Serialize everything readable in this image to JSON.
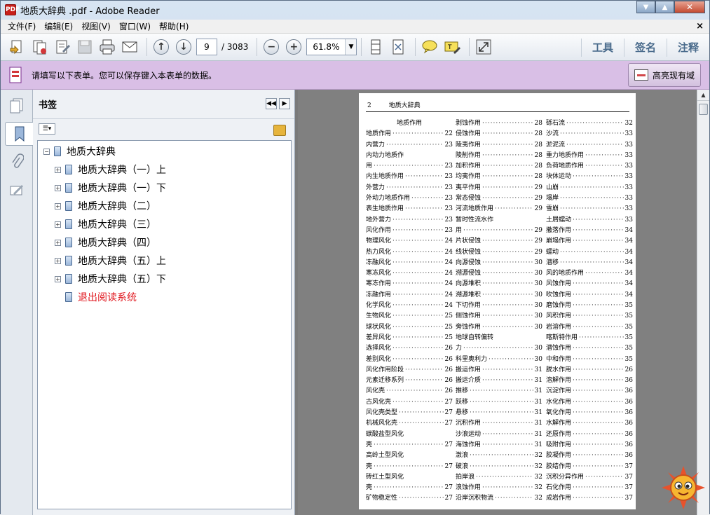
{
  "window": {
    "title": "地质大辞典 .pdf - Adobe Reader",
    "app_icon_label": "PDF"
  },
  "window_buttons": {
    "minimize": "▼",
    "maximize": "▲",
    "close": "✕"
  },
  "menu": {
    "items": [
      "文件(F)",
      "编辑(E)",
      "视图(V)",
      "窗口(W)",
      "帮助(H)"
    ],
    "close": "×"
  },
  "toolbar": {
    "page_current": "9",
    "page_total": "/ 3083",
    "zoom": "61.8%",
    "zoom_out": "−",
    "zoom_in": "+",
    "tools_label": "工具",
    "sign_label": "签名",
    "comment_label": "注释"
  },
  "form_bar": {
    "message": "请填写以下表单。您可以保存键入本表单的数据。",
    "highlight_button": "高亮现有域"
  },
  "bookmarks": {
    "title": "书签",
    "root": "地质大辞典",
    "items": [
      "地质大辞典（一）上",
      "地质大辞典（一）下",
      "地质大辞典（二）",
      "地质大辞典（三）",
      "地质大辞典（四）",
      "地质大辞典（五）上",
      "地质大辞典（五）下"
    ],
    "exit_item": "退出阅读系统"
  },
  "page": {
    "number": "2",
    "running_title": "地质大辞典",
    "columns": [
      [
        {
          "t": "地质作用",
          "h": true
        },
        {
          "t": "地质作用",
          "p": "22"
        },
        {
          "t": "内营力",
          "p": "23"
        },
        {
          "t": "内动力地质作",
          "nop": true
        },
        {
          "t": "用",
          "p": "23"
        },
        {
          "t": "内生地质作用",
          "p": "23"
        },
        {
          "t": "外营力",
          "p": "23"
        },
        {
          "t": "外动力地质作用",
          "p": "23"
        },
        {
          "t": "表生地质作用",
          "p": "23"
        },
        {
          "t": "地外营力",
          "p": "23"
        },
        {
          "t": "风化作用",
          "p": "23"
        },
        {
          "t": "物理风化",
          "p": "24"
        },
        {
          "t": "热力风化",
          "p": "24"
        },
        {
          "t": "冻融风化",
          "p": "24"
        },
        {
          "t": "寒冻风化",
          "p": "24"
        },
        {
          "t": "寒冻作用",
          "p": "24"
        },
        {
          "t": "冻融作用",
          "p": "24"
        },
        {
          "t": "化学风化",
          "p": "24"
        },
        {
          "t": "生物风化",
          "p": "25"
        },
        {
          "t": "球状风化",
          "p": "25"
        },
        {
          "t": "差异风化",
          "p": "25"
        },
        {
          "t": "选择风化",
          "p": "26"
        },
        {
          "t": "差别风化",
          "p": "26"
        },
        {
          "t": "风化作用阶段",
          "p": "26"
        },
        {
          "t": "元素迁移系列",
          "p": "26"
        },
        {
          "t": "风化壳",
          "p": "26"
        },
        {
          "t": "古风化壳",
          "p": "27"
        },
        {
          "t": "风化壳类型",
          "p": "27"
        },
        {
          "t": "机械风化壳",
          "p": "27"
        },
        {
          "t": "碳酸盐型风化",
          "nop": true
        },
        {
          "t": "壳",
          "p": "27"
        },
        {
          "t": "高岭土型风化",
          "nop": true
        },
        {
          "t": "壳",
          "p": "27"
        },
        {
          "t": "砖红土型风化",
          "nop": true
        },
        {
          "t": "壳",
          "p": "27"
        },
        {
          "t": "矿物稳定性",
          "p": "27"
        }
      ],
      [
        {
          "t": "剥蚀作用",
          "p": "28"
        },
        {
          "t": "侵蚀作用",
          "p": "28"
        },
        {
          "t": "陵夷作用",
          "p": "28"
        },
        {
          "t": "陵削作用",
          "p": "28"
        },
        {
          "t": "加积作用",
          "p": "28"
        },
        {
          "t": "均夷作用",
          "p": "28"
        },
        {
          "t": "夷平作用",
          "p": "29"
        },
        {
          "t": "常态侵蚀",
          "p": "29"
        },
        {
          "t": "河流地质作用",
          "p": "29"
        },
        {
          "t": "暂时性流水作",
          "nop": true
        },
        {
          "t": "用",
          "p": "29"
        },
        {
          "t": "片状侵蚀",
          "p": "29"
        },
        {
          "t": "线状侵蚀",
          "p": "29"
        },
        {
          "t": "向源侵蚀",
          "p": "30"
        },
        {
          "t": "溯源侵蚀",
          "p": "30"
        },
        {
          "t": "向源堆积",
          "p": "30"
        },
        {
          "t": "溯源堆积",
          "p": "30"
        },
        {
          "t": "下切作用",
          "p": "30"
        },
        {
          "t": "侧蚀作用",
          "p": "30"
        },
        {
          "t": "旁蚀作用",
          "p": "30"
        },
        {
          "t": "地球自转偏转",
          "nop": true
        },
        {
          "t": "力",
          "p": "30"
        },
        {
          "t": "科里奥利力",
          "p": "30"
        },
        {
          "t": "搬运作用",
          "p": "31"
        },
        {
          "t": "搬运介质",
          "p": "31"
        },
        {
          "t": "推移",
          "p": "31"
        },
        {
          "t": "跃移",
          "p": "31"
        },
        {
          "t": "悬移",
          "p": "31"
        },
        {
          "t": "沉积作用",
          "p": "31"
        },
        {
          "t": "沙浪运动",
          "p": "31"
        },
        {
          "t": "海蚀作用",
          "p": "31"
        },
        {
          "t": "激浪",
          "p": "32"
        },
        {
          "t": "破浪",
          "p": "32"
        },
        {
          "t": "拍岸浪",
          "p": "32"
        },
        {
          "t": "浪蚀作用",
          "p": "32"
        },
        {
          "t": "沿岸沉积物流",
          "p": "32"
        }
      ],
      [
        {
          "t": "砾石流",
          "p": "32"
        },
        {
          "t": "沙流",
          "p": "33"
        },
        {
          "t": "淤泥流",
          "p": "33"
        },
        {
          "t": "重力地质作用",
          "p": "33"
        },
        {
          "t": "负荷地质作用",
          "p": "33"
        },
        {
          "t": "块体运动",
          "p": "33"
        },
        {
          "t": "山崩",
          "p": "33"
        },
        {
          "t": "塌岸",
          "p": "33"
        },
        {
          "t": "雪崩",
          "p": "33"
        },
        {
          "t": "土屑蠕动",
          "p": "33"
        },
        {
          "t": "撒落作用",
          "p": "34"
        },
        {
          "t": "崩塌作用",
          "p": "34"
        },
        {
          "t": "蠕动",
          "p": "34"
        },
        {
          "t": "潜移",
          "p": "34"
        },
        {
          "t": "风的地质作用",
          "p": "34"
        },
        {
          "t": "风蚀作用",
          "p": "34"
        },
        {
          "t": "吹蚀作用",
          "p": "34"
        },
        {
          "t": "磨蚀作用",
          "p": "35"
        },
        {
          "t": "风积作用",
          "p": "35"
        },
        {
          "t": "岩溶作用",
          "p": "35"
        },
        {
          "t": "喀斯特作用",
          "p": "35"
        },
        {
          "t": "潜蚀作用",
          "p": "35"
        },
        {
          "t": "中和作用",
          "p": "35"
        },
        {
          "t": "脱水作用",
          "p": "26"
        },
        {
          "t": "溶解作用",
          "p": "36"
        },
        {
          "t": "沉淀作用",
          "p": "36"
        },
        {
          "t": "水化作用",
          "p": "36"
        },
        {
          "t": "氧化作用",
          "p": "36"
        },
        {
          "t": "水解作用",
          "p": "36"
        },
        {
          "t": "还原作用",
          "p": "36"
        },
        {
          "t": "吸附作用",
          "p": "36"
        },
        {
          "t": "胶凝作用",
          "p": "36"
        },
        {
          "t": "胶结作用",
          "p": "37"
        },
        {
          "t": "沉积分异作用",
          "p": "37"
        },
        {
          "t": "石化作用",
          "p": "37"
        },
        {
          "t": "成岩作用",
          "p": "37"
        }
      ]
    ]
  }
}
